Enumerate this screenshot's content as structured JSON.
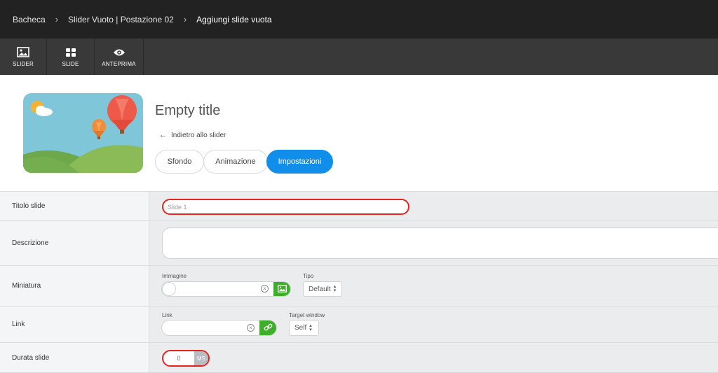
{
  "breadcrumb": {
    "items": [
      "Bacheca",
      "Slider Vuoto | Postazione 02",
      "Aggiungi slide vuota"
    ],
    "separator": ">"
  },
  "toolbar": {
    "items": [
      {
        "label": "SLIDER",
        "icon": "image-icon"
      },
      {
        "label": "SLIDE",
        "icon": "grid-icon"
      },
      {
        "label": "ANTEPRIMA",
        "icon": "eye-icon"
      }
    ]
  },
  "header": {
    "title": "Empty title",
    "back_link": "Indietro allo slider",
    "tabs": [
      {
        "label": "Sfondo",
        "active": false
      },
      {
        "label": "Animazione",
        "active": false
      },
      {
        "label": "Impostazioni",
        "active": true
      }
    ]
  },
  "form": {
    "rows": [
      {
        "label": "Titolo slide"
      },
      {
        "label": "Descrizione"
      },
      {
        "label": "Miniatura"
      },
      {
        "label": "Link"
      },
      {
        "label": "Durata slide"
      }
    ],
    "title_input": {
      "value": "Slide 1"
    },
    "description_input": {
      "value": ""
    },
    "thumbnail": {
      "image_label": "Immagine",
      "type_label": "Tipo",
      "type_value": "Default"
    },
    "link": {
      "link_label": "Link",
      "target_label": "Target window",
      "target_value": "Self"
    },
    "duration": {
      "value": "0",
      "unit": "MS"
    }
  },
  "colors": {
    "topbar": "#222222",
    "toolbar": "#393939",
    "accent": "#108ee9",
    "highlight": "#e8231d",
    "green": "#3fae2a"
  }
}
